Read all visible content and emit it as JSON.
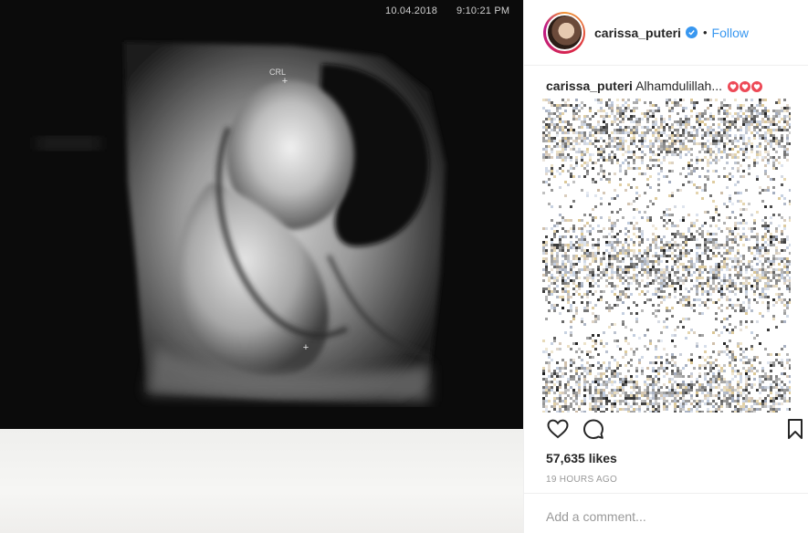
{
  "photo": {
    "date_text": "10.04.2018",
    "time_text": "9:10:21 PM",
    "caliper_label": "CRL"
  },
  "post": {
    "username": "carissa_puteri",
    "verified_icon": "verified-badge-icon",
    "separator": "•",
    "follow_label": "Follow",
    "caption_user": "carissa_puteri",
    "caption_text": "Alhamdulillah...",
    "caption_hearts": 3,
    "likes_text": "57,635 likes",
    "time_ago": "19 HOURS AGO",
    "comment_placeholder": "Add a comment..."
  },
  "icons": {
    "like": "heart-outline-icon",
    "comment": "comment-bubble-icon",
    "save": "bookmark-icon"
  },
  "colors": {
    "link_blue": "#3897f0",
    "heart_pink": "#ed4956",
    "border": "#efefef",
    "muted_text": "#999999"
  }
}
